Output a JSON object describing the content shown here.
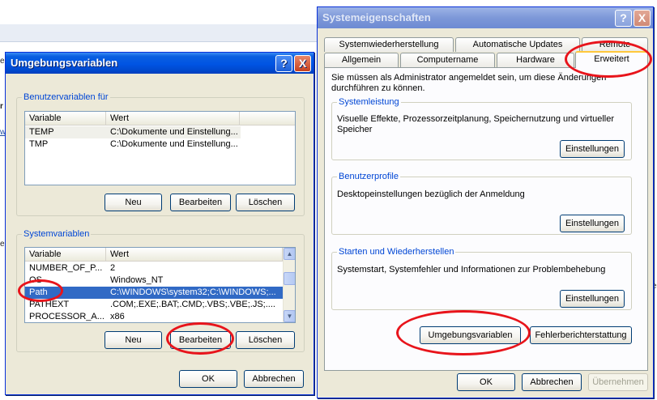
{
  "background": {
    "fragments": [
      "ei",
      "r",
      "w",
      "ei",
      "se"
    ]
  },
  "env_dialog": {
    "title": "Umgebungsvariablen",
    "help_glyph": "?",
    "close_glyph": "X",
    "user_group": {
      "label": "Benutzervariablen für",
      "columns": [
        "Variable",
        "Wert"
      ],
      "rows": [
        {
          "variable": "TEMP",
          "value": "C:\\Dokumente und Einstellung..."
        },
        {
          "variable": "TMP",
          "value": "C:\\Dokumente und Einstellung..."
        }
      ],
      "buttons": {
        "new": "Neu",
        "edit": "Bearbeiten",
        "delete": "Löschen"
      }
    },
    "system_group": {
      "label": "Systemvariablen",
      "columns": [
        "Variable",
        "Wert"
      ],
      "rows": [
        {
          "variable": "NUMBER_OF_P...",
          "value": "2"
        },
        {
          "variable": "OS",
          "value": "Windows_NT"
        },
        {
          "variable": "Path",
          "value": "C:\\WINDOWS\\system32;C:\\WINDOWS;..."
        },
        {
          "variable": "PATHEXT",
          "value": ".COM;.EXE;.BAT;.CMD;.VBS;.VBE;.JS;...."
        },
        {
          "variable": "PROCESSOR_A...",
          "value": "x86"
        }
      ],
      "selected_row": 2,
      "buttons": {
        "new": "Neu",
        "edit": "Bearbeiten",
        "delete": "Löschen"
      }
    },
    "ok": "OK",
    "cancel": "Abbrechen"
  },
  "sys_dialog": {
    "title": "Systemeigenschaften",
    "help_glyph": "?",
    "close_glyph": "X",
    "tabs_back": [
      "Systemwiederherstellung",
      "Automatische Updates",
      "Remote"
    ],
    "tabs_front": [
      "Allgemein",
      "Computername",
      "Hardware",
      "Erweitert"
    ],
    "active_tab": "Erweitert",
    "admin_note": "Sie müssen als Administrator angemeldet sein, um diese Änderungen durchführen zu können.",
    "performance": {
      "label": "Systemleistung",
      "text": "Visuelle Effekte, Prozessorzeitplanung, Speichernutzung und virtueller Speicher",
      "button": "Einstellungen"
    },
    "profiles": {
      "label": "Benutzerprofile",
      "text": "Desktopeinstellungen bezüglich der Anmeldung",
      "button": "Einstellungen"
    },
    "startup": {
      "label": "Starten und Wiederherstellen",
      "text": "Systemstart, Systemfehler und Informationen zur Problembehebung",
      "button": "Einstellungen"
    },
    "env_button": "Umgebungsvariablen",
    "error_report_button": "Fehlerberichterstattung",
    "ok": "OK",
    "cancel": "Abbrechen",
    "apply": "Übernehmen"
  },
  "colors": {
    "annotation": "#e8141b",
    "selection": "#316ac5",
    "titlebar": "#0054e3",
    "group_label": "#0046d5"
  }
}
